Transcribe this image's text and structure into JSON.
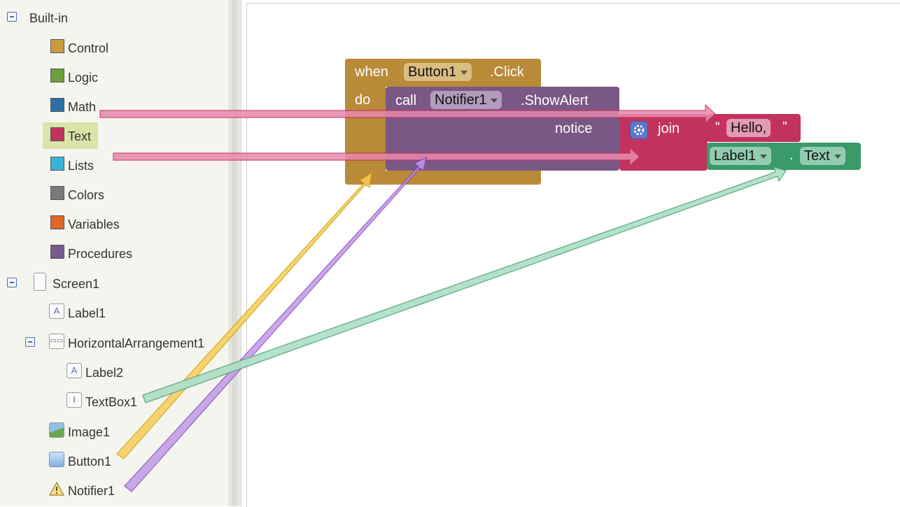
{
  "tree": {
    "builtin_label": "Built-in",
    "builtin_items": [
      {
        "label": "Control",
        "color": "#c99b3f"
      },
      {
        "label": "Logic",
        "color": "#6f9f3a"
      },
      {
        "label": "Math",
        "color": "#2f6fa8"
      },
      {
        "label": "Text",
        "color": "#c2325e"
      },
      {
        "label": "Lists",
        "color": "#38b4d8"
      },
      {
        "label": "Colors",
        "color": "#7a7a7a"
      },
      {
        "label": "Variables",
        "color": "#e0662a"
      },
      {
        "label": "Procedures",
        "color": "#7a5a8e"
      }
    ],
    "screen_label": "Screen1",
    "components": {
      "label1": "Label1",
      "harr": "HorizontalArrangement1",
      "label2": "Label2",
      "textbox": "TextBox1",
      "image": "Image1",
      "button": "Button1",
      "notifier": "Notifier1"
    }
  },
  "blocks": {
    "event": {
      "when": "when",
      "component": "Button1",
      "event": ".Click",
      "do": "do"
    },
    "call": {
      "call": "call",
      "component": "Notifier1",
      "method": ".ShowAlert",
      "arg": "notice"
    },
    "join": {
      "label": "join"
    },
    "text_literal": {
      "open_quote": "“",
      "value": "Hello,",
      "close_quote": "”"
    },
    "getter": {
      "component": "Label1",
      "dot": ".",
      "property": "Text"
    }
  },
  "colors": {
    "event": "#b98a37",
    "call": "#7a5886",
    "text": "#c2325e",
    "component": "#3a9a6a",
    "arrow_pink": "#e889ad",
    "arrow_yellow": "#f9cc5a",
    "arrow_purple": "#c19ae6",
    "arrow_green": "#a8dcc1"
  }
}
